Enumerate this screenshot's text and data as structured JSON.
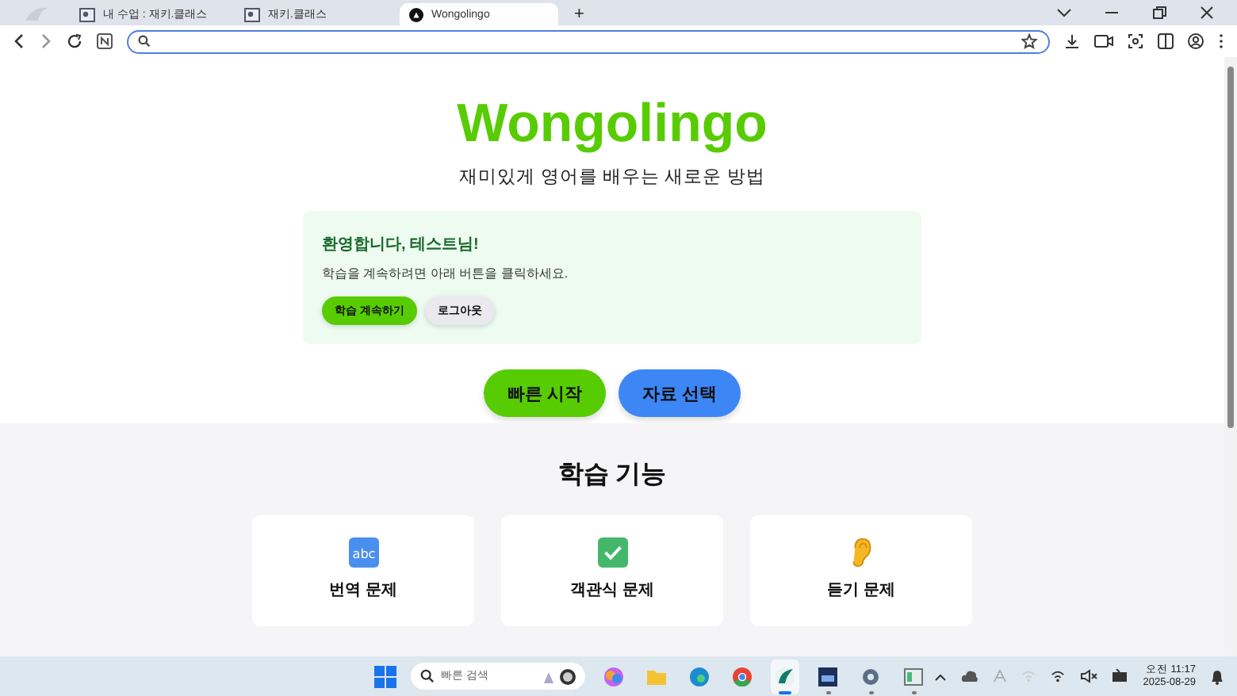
{
  "browser": {
    "tabs": [
      {
        "label": "내 수업 : 재키.클래스",
        "selected": false
      },
      {
        "label": "재키.클래스",
        "selected": false
      },
      {
        "label": "Wongolingo",
        "selected": true
      }
    ],
    "new_tab": "+"
  },
  "hero": {
    "title": "Wongolingo",
    "subtitle": "재미있게 영어를 배우는 새로운 방법"
  },
  "welcome": {
    "heading": "환영합니다, 테스트님!",
    "message": "학습을 계속하려면 아래 버튼을 클릭하세요.",
    "buttons": [
      {
        "label": "학습 계속하기",
        "kind": "primary"
      },
      {
        "label": "로그아웃",
        "kind": "secondary"
      }
    ]
  },
  "actions": [
    {
      "label": "빠른 시작",
      "kind": "green"
    },
    {
      "label": "자료 선택",
      "kind": "blue"
    }
  ],
  "features": {
    "heading": "학습 기능",
    "cards": [
      {
        "title": "번역 문제",
        "kind": "abc"
      },
      {
        "title": "객관식 문제",
        "kind": "check"
      },
      {
        "title": "듣기 문제",
        "kind": "ear"
      }
    ]
  },
  "taskbar": {
    "search_placeholder": "빠른 검색",
    "time": "오전 11:17",
    "date": "2025-08-29",
    "apps": [
      {
        "kind": "copilot",
        "open": false,
        "selected": false
      },
      {
        "kind": "folder",
        "open": false,
        "selected": false
      },
      {
        "kind": "edge",
        "open": false,
        "selected": false
      },
      {
        "kind": "chrome",
        "open": false,
        "selected": false
      },
      {
        "kind": "app",
        "open": true,
        "selected": true
      },
      {
        "kind": "monitor",
        "open": true,
        "selected": false
      },
      {
        "kind": "settings",
        "open": true,
        "selected": false
      },
      {
        "kind": "window",
        "open": true,
        "selected": false
      }
    ]
  }
}
